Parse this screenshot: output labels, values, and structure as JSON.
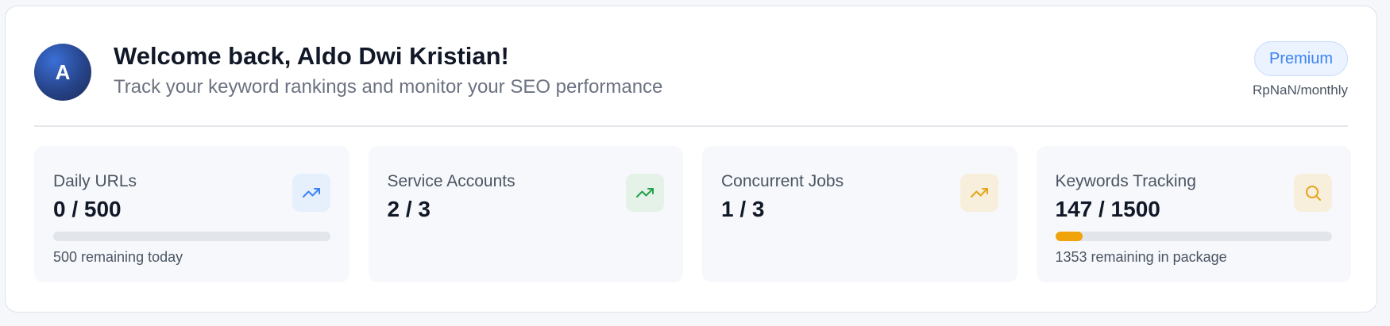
{
  "user": {
    "avatar_initial": "A",
    "welcome": "Welcome back, Aldo Dwi Kristian!",
    "subtitle": "Track your keyword rankings and monitor your SEO performance"
  },
  "plan": {
    "name": "Premium",
    "price": "RpNaN/monthly"
  },
  "stats": [
    {
      "label": "Daily URLs",
      "value": "0 / 500",
      "icon": "trending-up-icon",
      "icon_color": "#3b82f6",
      "icon_bg": "#e6f0fc",
      "progress": 0,
      "progress_color": "#3b82f6",
      "caption": "500 remaining today"
    },
    {
      "label": "Service Accounts",
      "value": "2 / 3",
      "icon": "trending-up-icon",
      "icon_color": "#22a24a",
      "icon_bg": "#e4f2e8"
    },
    {
      "label": "Concurrent Jobs",
      "value": "1 / 3",
      "icon": "trending-up-icon",
      "icon_color": "#e6a31a",
      "icon_bg": "#f7eedb"
    },
    {
      "label": "Keywords Tracking",
      "value": "147 / 1500",
      "icon": "search-icon",
      "icon_color": "#e6a31a",
      "icon_bg": "#f7eedb",
      "progress": 0.098,
      "progress_color": "#f0a30a",
      "caption": "1353 remaining in package"
    }
  ]
}
